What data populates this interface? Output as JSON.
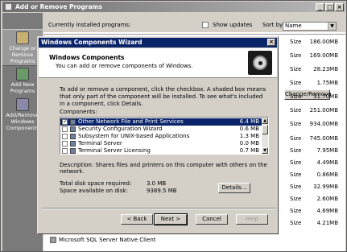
{
  "window": {
    "title": "Add or Remove Programs"
  },
  "sidebar": {
    "items": [
      {
        "label": "Change or Remove Programs",
        "icon": "change-remove-icon",
        "lines": [
          "Change or",
          "Remove",
          "Programs"
        ]
      },
      {
        "label": "Add New Programs",
        "icon": "add-programs-icon",
        "lines": [
          "Add New",
          "Programs"
        ]
      },
      {
        "label": "Add/Remove Windows Components",
        "icon": "windows-components-icon",
        "lines": [
          "Add/Remove",
          "Windows",
          "Components"
        ]
      }
    ]
  },
  "topbar": {
    "currently_installed": "Currently installed programs:",
    "show_updates": "Show updates",
    "sort_by": "Sort by:",
    "sort_value": "Name"
  },
  "programs": {
    "change_remove_button": "Change/Remove",
    "size_label": "Size",
    "sizes": [
      "186.00MB",
      "169.00MB",
      "28.23MB",
      "1.75MB",
      "31.70MB",
      "251.00MB",
      "934.00MB",
      "745.00MB",
      "7.95MB",
      "4.49MB",
      "0.86MB",
      "32.99MB",
      "2.60MB",
      "4.69MB",
      "4.21MB"
    ],
    "visible_rows": [
      "Microsoft SQL Server Native Client"
    ]
  },
  "wizard": {
    "title": "Windows Components Wizard",
    "header_title": "Windows Components",
    "header_subtitle": "You can add or remove components of Windows.",
    "instructions": "To add or remove a component, click the checkbox. A shaded box means that only part of the component will be installed. To see what's included in a component, click Details.",
    "components_label": "Components:",
    "components": [
      {
        "name": "Other Network File and Print Services",
        "size": "6.4 MB",
        "checked": true
      },
      {
        "name": "Security Configuration Wizard",
        "size": "0.6 MB",
        "checked": false
      },
      {
        "name": "Subsystem for UNIX-based Applications",
        "size": "1.3 MB",
        "checked": false
      },
      {
        "name": "Terminal Server",
        "size": "0.0 MB",
        "checked": false
      },
      {
        "name": "Terminal Server Licensing",
        "size": "0.7 MB",
        "checked": false
      }
    ],
    "description": "Description:  Shares files and printers on this computer with others on the network.",
    "total_label": "Total disk space required:",
    "total_value": "3.0 MB",
    "avail_label": "Space available on disk:",
    "avail_value": "9389.5 MB",
    "details_button": "Details...",
    "back_button": "< Back",
    "next_button": "Next >",
    "cancel_button": "Cancel",
    "help_button": "Help"
  }
}
